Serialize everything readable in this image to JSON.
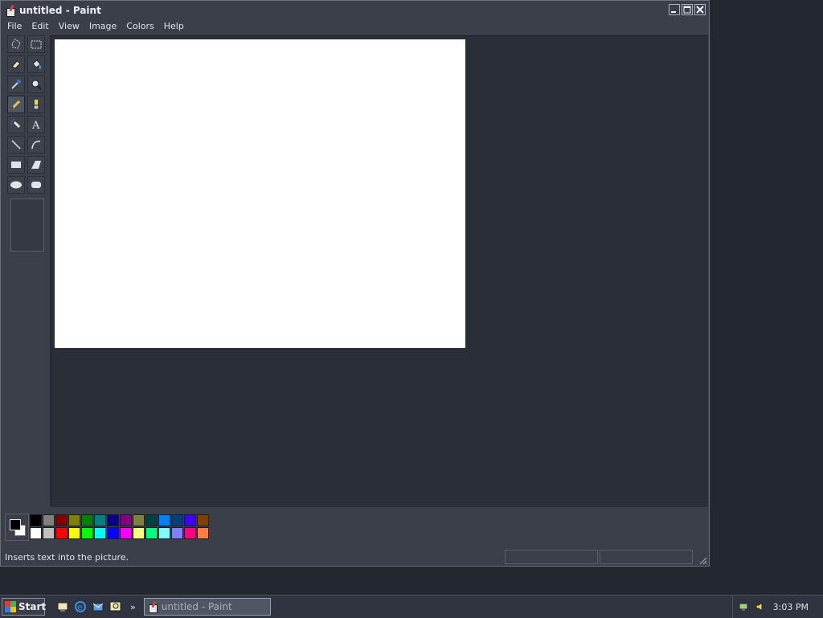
{
  "window": {
    "title": "untitled - Paint",
    "controls": [
      "minimize",
      "maximize",
      "close"
    ]
  },
  "menu": [
    "File",
    "Edit",
    "View",
    "Image",
    "Colors",
    "Help"
  ],
  "tools": [
    {
      "name": "free-form-select",
      "icon": "free-form-select-icon"
    },
    {
      "name": "select",
      "icon": "rect-select-icon"
    },
    {
      "name": "eraser",
      "icon": "eraser-icon"
    },
    {
      "name": "fill",
      "icon": "fill-bucket-icon"
    },
    {
      "name": "pick-color",
      "icon": "eyedropper-icon"
    },
    {
      "name": "magnifier",
      "icon": "magnifier-icon"
    },
    {
      "name": "pencil",
      "icon": "pencil-icon",
      "active": true
    },
    {
      "name": "brush",
      "icon": "brush-icon"
    },
    {
      "name": "airbrush",
      "icon": "airbrush-icon"
    },
    {
      "name": "text",
      "icon": "text-icon",
      "label": "A"
    },
    {
      "name": "line",
      "icon": "line-icon"
    },
    {
      "name": "curve",
      "icon": "curve-icon"
    },
    {
      "name": "rectangle",
      "icon": "rectangle-icon"
    },
    {
      "name": "polygon",
      "icon": "polygon-icon"
    },
    {
      "name": "ellipse",
      "icon": "ellipse-icon"
    },
    {
      "name": "rounded-rectangle",
      "icon": "rounded-rectangle-icon"
    }
  ],
  "palette": {
    "foreground": "#000000",
    "background": "#ffffff",
    "row1": [
      "#000000",
      "#808080",
      "#800000",
      "#808000",
      "#008000",
      "#008080",
      "#000080",
      "#800080",
      "#808040",
      "#004040",
      "#0080ff",
      "#004080",
      "#4000ff",
      "#804000"
    ],
    "row2": [
      "#ffffff",
      "#c0c0c0",
      "#ff0000",
      "#ffff00",
      "#00ff00",
      "#00ffff",
      "#0000ff",
      "#ff00ff",
      "#ffff80",
      "#00ff80",
      "#80ffff",
      "#8080ff",
      "#ff0080",
      "#ff8040"
    ]
  },
  "status": {
    "text": "Inserts text into the picture."
  },
  "taskbar": {
    "start_label": "Start",
    "quicklaunch": [
      "desktop-icon",
      "internet-explorer-icon",
      "outlook-express-icon",
      "search-icon"
    ],
    "task_label": "untitled - Paint",
    "clock": "3:03 PM"
  }
}
